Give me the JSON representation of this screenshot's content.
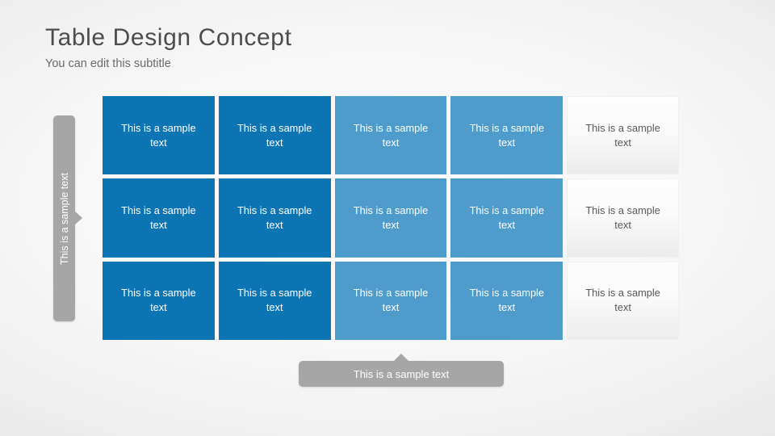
{
  "header": {
    "title": "Table Design Concept",
    "subtitle": "You can edit this subtitle"
  },
  "side_label": {
    "text": "This is a sample text"
  },
  "bottom_label": {
    "text": "This is a sample text"
  },
  "table": {
    "cell_text": "This is a sample text",
    "columns": [
      {
        "style": "dark",
        "color": "#0e75b5"
      },
      {
        "style": "dark",
        "color": "#0e75b5"
      },
      {
        "style": "mid",
        "color": "#4d9ccc"
      },
      {
        "style": "mid",
        "color": "#4d9ccc"
      },
      {
        "style": "light",
        "color": "#fafafa"
      }
    ],
    "rows": [
      [
        "This is a sample text",
        "This is a sample text",
        "This is a sample text",
        "This is a sample text",
        "This is a sample text"
      ],
      [
        "This is a sample text",
        "This is a sample text",
        "This is a sample text",
        "This is a sample text",
        "This is a sample text"
      ],
      [
        "This is a sample text",
        "This is a sample text",
        "This is a sample text",
        "This is a sample text",
        "This is a sample text"
      ]
    ]
  },
  "colors": {
    "accent_dark": "#0e75b5",
    "accent_mid": "#4d9ccc",
    "neutral_gray": "#a6a6a6",
    "title_text": "#4d4d4d",
    "subtitle_text": "#6b6b6b"
  }
}
